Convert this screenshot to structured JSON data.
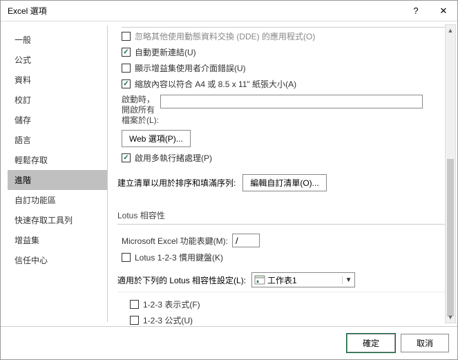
{
  "window": {
    "title": "Excel 選項",
    "help": "?",
    "close": "✕"
  },
  "sidebar": {
    "items": [
      {
        "label": "一般"
      },
      {
        "label": "公式"
      },
      {
        "label": "資料"
      },
      {
        "label": "校訂"
      },
      {
        "label": "儲存"
      },
      {
        "label": "語言"
      },
      {
        "label": "輕鬆存取"
      },
      {
        "label": "進階"
      },
      {
        "label": "自訂功能區"
      },
      {
        "label": "快速存取工具列"
      },
      {
        "label": "增益集"
      },
      {
        "label": "信任中心"
      }
    ],
    "selected_index": 7
  },
  "content": {
    "partial_top": "忽略其他使用動態資料交換 (DDE) 的應用程式(O)",
    "auto_update_links": "自動更新連結(U)",
    "show_addin_errors": "顯示增益集使用者介面錯誤(U)",
    "fit_paper": "縮放內容以符合 A4 或 8.5 x 11\" 紙張大小(A)",
    "open_all_label": "啟動時，開啟所有檔案於(L):",
    "open_all_value": "",
    "web_options": "Web 選項(P)...",
    "multithread": "啟用多執行緒處理(P)",
    "sort_label": "建立清單以用於排序和填滿序列:",
    "edit_lists": "編輯自訂清單(O)...",
    "section_lotus": "Lotus 相容性",
    "menu_key_label": "Microsoft Excel 功能表鍵(M):",
    "menu_key_value": "/",
    "lotus_keyboard": "Lotus 1-2-3 慣用鍵盤(K)",
    "applies_to_label": "適用於下列的 Lotus 相容性設定(L):",
    "sheet_selected": "工作表1",
    "expr_123": "1-2-3 表示式(F)",
    "formula_123": "1-2-3 公式(U)"
  },
  "footer": {
    "ok": "確定",
    "cancel": "取消"
  }
}
